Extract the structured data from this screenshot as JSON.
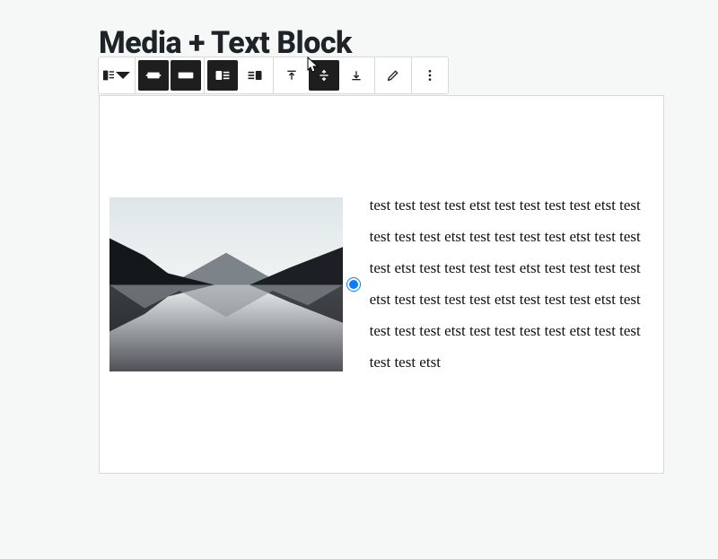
{
  "title": "Media + Text Block",
  "toolbar": {
    "block_type": "media-text",
    "align_wide": true,
    "align_full": false,
    "media_left": true,
    "media_right": false,
    "valign_top": false,
    "valign_middle": true,
    "valign_bottom": false,
    "edit_url": "edit",
    "more": "more"
  },
  "content": {
    "paragraph": "test test test test etst test test test test etst test test test test etst test test test test etst test test test etst test test test test etst test test test test etst test test test test etst test test test etst test test test test etst test test test test etst test test test test etst"
  }
}
